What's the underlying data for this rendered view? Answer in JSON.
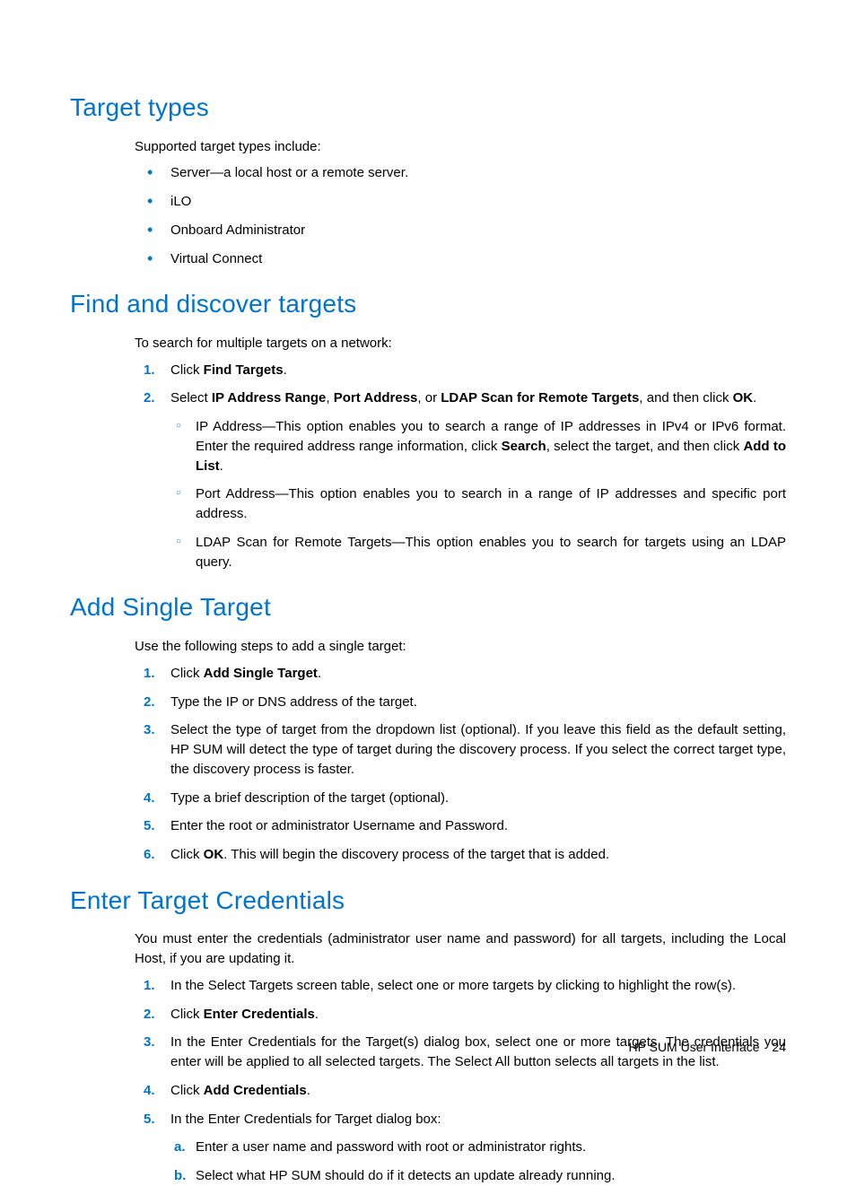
{
  "sections": {
    "target_types": {
      "heading": "Target types",
      "intro": "Supported target types include:",
      "bullets": [
        "Server—a local host or a remote server.",
        "iLO",
        "Onboard Administrator",
        "Virtual Connect"
      ]
    },
    "find_discover": {
      "heading": "Find and discover targets",
      "intro": "To search for multiple targets on a network:",
      "steps": {
        "s1_pre": "Click ",
        "s1_b": "Find Targets",
        "s1_post": ".",
        "s2_pre": "Select ",
        "s2_b1": "IP Address Range",
        "s2_mid1": ", ",
        "s2_b2": "Port Address",
        "s2_mid2": ", or ",
        "s2_b3": "LDAP Scan for Remote Targets",
        "s2_mid3": ", and then click ",
        "s2_b4": "OK",
        "s2_post": ".",
        "sub1_pre": "IP Address—This option enables you to search a range of IP addresses in IPv4 or IPv6 format. Enter the required address range information, click ",
        "sub1_b1": "Search",
        "sub1_mid": ", select the target, and then click ",
        "sub1_b2": "Add to List",
        "sub1_post": ".",
        "sub2": "Port Address—This option enables you to search in a range of IP addresses and specific port address.",
        "sub3": "LDAP Scan for Remote Targets—This option enables you to search for targets using an LDAP query."
      }
    },
    "add_single": {
      "heading": "Add Single Target",
      "intro": "Use the following steps to add a single target:",
      "steps": {
        "s1_pre": "Click ",
        "s1_b": "Add Single Target",
        "s1_post": ".",
        "s2": "Type the IP or DNS address of the target.",
        "s3": "Select the type of target from the dropdown list (optional). If you leave this field as the default setting, HP SUM will detect the type of target during the discovery process. If you select the correct target type, the discovery process is faster.",
        "s4": "Type a brief description of the target (optional).",
        "s5": "Enter the root or administrator Username and Password.",
        "s6_pre": "Click ",
        "s6_b": "OK",
        "s6_post": ". This will begin the discovery process of the target that is added."
      }
    },
    "enter_creds": {
      "heading": "Enter Target Credentials",
      "intro": "You must enter the credentials (administrator user name and password) for all targets, including the Local Host, if you are updating it.",
      "steps": {
        "s1": "In the Select Targets screen table, select one or more targets by clicking to highlight the row(s).",
        "s2_pre": "Click ",
        "s2_b": "Enter Credentials",
        "s2_post": ".",
        "s3": "In the Enter Credentials for the Target(s) dialog box, select one or more targets. The credentials you enter will be applied to all selected targets. The Select All button selects all targets in the list.",
        "s4_pre": "Click ",
        "s4_b": "Add Credentials",
        "s4_post": ".",
        "s5": "In the Enter Credentials for Target dialog box:",
        "s5a": "Enter a user name and password with root or administrator rights.",
        "s5b": "Select what HP SUM should do if it detects an update already running."
      }
    }
  },
  "footer": {
    "text": "HP SUM User Interface",
    "page": "24"
  }
}
